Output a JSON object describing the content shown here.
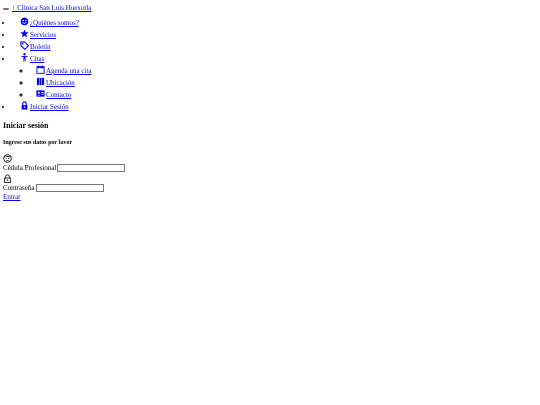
{
  "navbar": {
    "brand": "Clínica San Luis Huexotla",
    "toggle_icon": "menu-toggle"
  },
  "menu": {
    "items": [
      {
        "label": "¿Quiénes somos?",
        "icon": "smiley-face-icon"
      },
      {
        "label": "Servicios",
        "icon": "star-icon"
      },
      {
        "label": "Boletín",
        "icon": "tag-icon"
      },
      {
        "label": "Citas",
        "icon": "person-icon"
      },
      {
        "label": "Iniciar Sesión",
        "icon": "lock-icon"
      }
    ],
    "citas_sub": [
      {
        "label": "Agenda una cita",
        "icon": "calendar-icon"
      },
      {
        "label": "Ubicación",
        "icon": "map-icon"
      },
      {
        "label": "Contacto",
        "icon": "contact-card-icon"
      }
    ]
  },
  "login": {
    "title": "Iniciar sesión",
    "subtitle": "Ingrese sus datos por favor",
    "cedula_label": "Cédula Profesional",
    "cedula_value": "",
    "password_label": "Contraseña",
    "password_value": "",
    "submit_label": "Entrar"
  }
}
